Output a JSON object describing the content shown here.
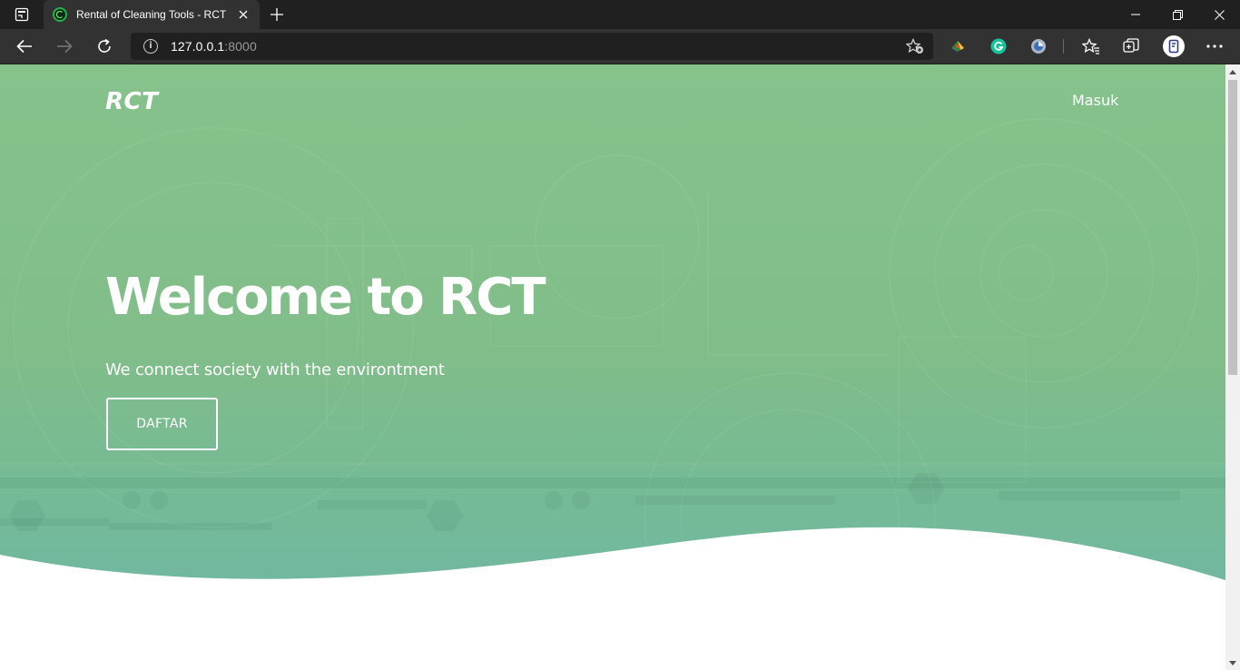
{
  "browser": {
    "tab": {
      "title": "Rental of Cleaning Tools - RCT",
      "favicon": "rct-favicon-icon"
    },
    "address": {
      "host": "127.0.0.1",
      "port": ":8000"
    }
  },
  "page": {
    "brand": "RCT",
    "nav": {
      "login_label": "Masuk"
    },
    "hero": {
      "title": "Welcome to RCT",
      "subtitle": "We connect society with the environtment",
      "cta_label": "DAFTAR"
    }
  },
  "colors": {
    "hero_top": "#86c38b",
    "hero_bottom": "#71b7a0",
    "chrome_dark": "#202020",
    "chrome_toolbar": "#323232"
  }
}
